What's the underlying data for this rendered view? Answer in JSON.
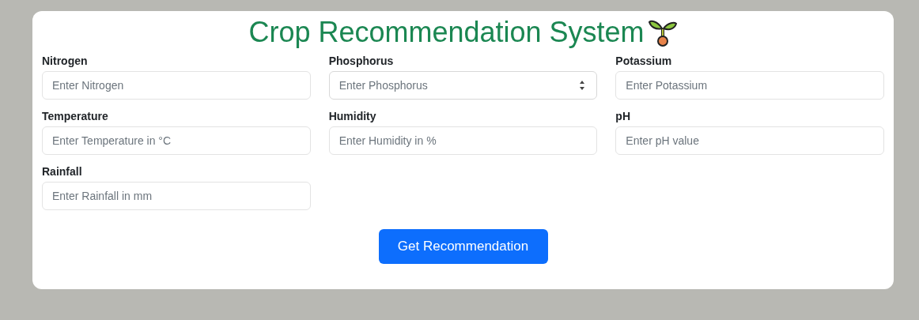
{
  "title": "Crop Recommendation System",
  "fields": [
    {
      "label": "Nitrogen",
      "placeholder": "Enter Nitrogen",
      "hovered": false
    },
    {
      "label": "Phosphorus",
      "placeholder": "Enter Phosphorus",
      "hovered": true
    },
    {
      "label": "Potassium",
      "placeholder": "Enter Potassium",
      "hovered": false
    },
    {
      "label": "Temperature",
      "placeholder": "Enter Temperature in °C",
      "hovered": false
    },
    {
      "label": "Humidity",
      "placeholder": "Enter Humidity in %",
      "hovered": false
    },
    {
      "label": "pH",
      "placeholder": "Enter pH value",
      "hovered": false
    },
    {
      "label": "Rainfall",
      "placeholder": "Enter Rainfall in mm",
      "hovered": false
    }
  ],
  "submit_button": "Get Recommendation"
}
